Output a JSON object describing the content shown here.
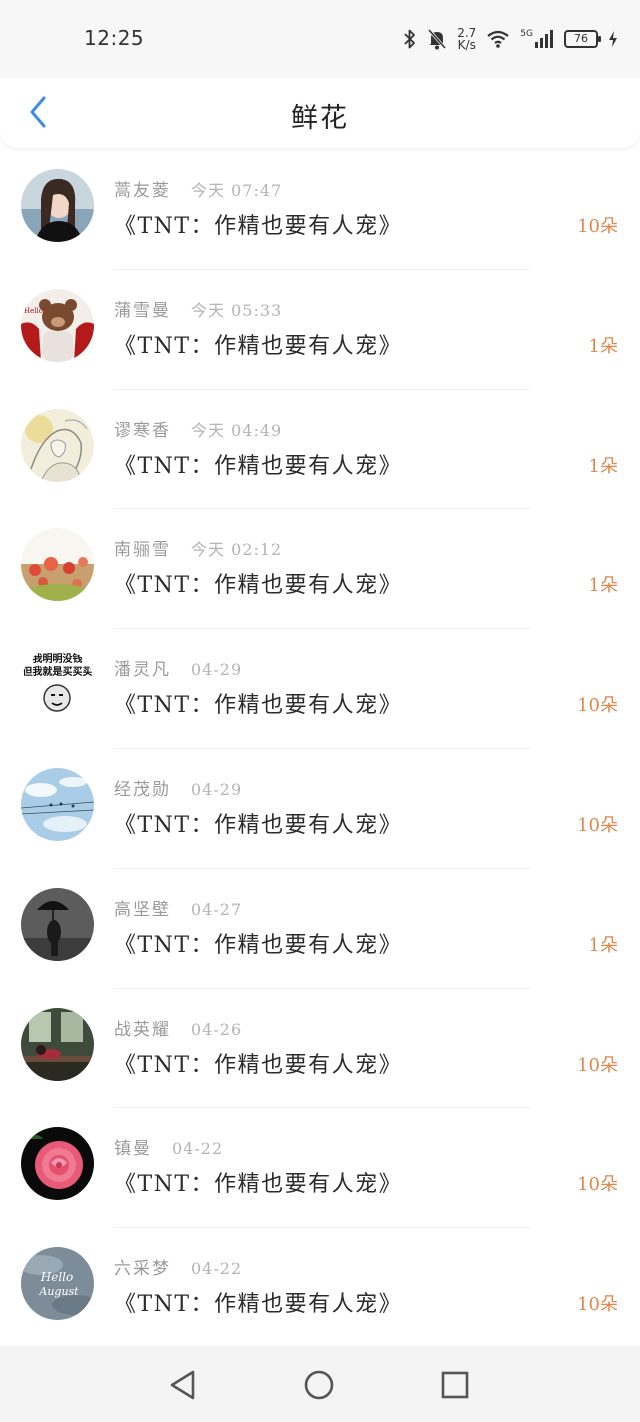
{
  "status_bar": {
    "time": "12:25",
    "net_speed_value": "2.7",
    "net_speed_unit": "K/s",
    "network_label": "5G",
    "battery_level": "76"
  },
  "header": {
    "title": "鲜花"
  },
  "colors": {
    "accent": "#3a8ee6",
    "count": "#e0874d"
  },
  "flower_list": [
    {
      "user": "蒿友菱",
      "time": "今天 07:47",
      "title": "《TNT：作精也要有人宠》",
      "count": "10朵",
      "avatar": "girl-portrait"
    },
    {
      "user": "蒲雪曼",
      "time": "今天 05:33",
      "title": "《TNT：作精也要有人宠》",
      "count": "1朵",
      "avatar": "bear-red"
    },
    {
      "user": "谬寒香",
      "time": "今天 04:49",
      "title": "《TNT：作精也要有人宠》",
      "count": "1朵",
      "avatar": "sketch-girl"
    },
    {
      "user": "南骊雪",
      "time": "今天 02:12",
      "title": "《TNT：作精也要有人宠》",
      "count": "1朵",
      "avatar": "flower-field"
    },
    {
      "user": "潘灵凡",
      "time": "04-29",
      "title": "《TNT：作精也要有人宠》",
      "count": "10朵",
      "avatar": "meme-face"
    },
    {
      "user": "经茂勋",
      "time": "04-29",
      "title": "《TNT：作精也要有人宠》",
      "count": "10朵",
      "avatar": "blue-sky"
    },
    {
      "user": "高坚壁",
      "time": "04-27",
      "title": "《TNT：作精也要有人宠》",
      "count": "1朵",
      "avatar": "umbrella-person"
    },
    {
      "user": "战英耀",
      "time": "04-26",
      "title": "《TNT：作精也要有人宠》",
      "count": "10朵",
      "avatar": "classroom"
    },
    {
      "user": "镇曼",
      "time": "04-22",
      "title": "《TNT：作精也要有人宠》",
      "count": "10朵",
      "avatar": "pink-rose"
    },
    {
      "user": "六采梦",
      "time": "04-22",
      "title": "《TNT：作精也要有人宠》",
      "count": "10朵",
      "avatar": "hello-august"
    }
  ],
  "avatar_texts": {
    "bear_tag": "Hello!",
    "meme_line1": "我明明没钱",
    "meme_line2": "但我就是买买买",
    "august_line1": "Hello",
    "august_line2": "August"
  },
  "navigation_bar": {
    "back": "back-triangle-icon",
    "home": "home-circle-icon",
    "recents": "recents-square-icon"
  }
}
